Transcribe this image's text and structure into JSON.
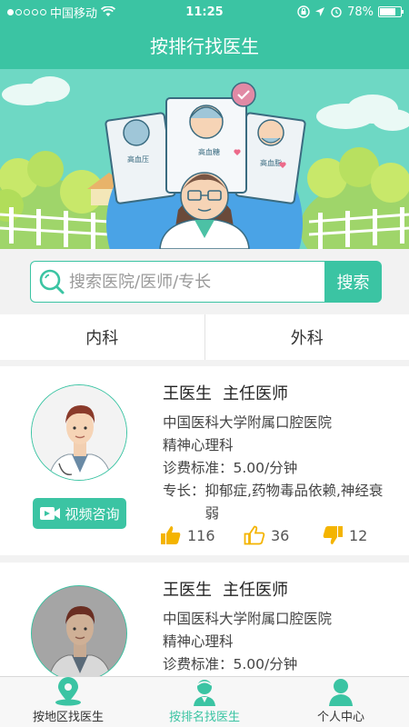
{
  "status_bar": {
    "carrier": "中国移动",
    "time": "11:25",
    "battery": "78%",
    "battery_level": 0.78
  },
  "header": {
    "title": "按排行找医生"
  },
  "banner": {
    "labels": [
      "高血压",
      "高血糖",
      "高血脂"
    ]
  },
  "search": {
    "placeholder": "搜索医院/医师/专长",
    "button_label": "搜索"
  },
  "tabs": [
    {
      "label": "内科"
    },
    {
      "label": "外科"
    }
  ],
  "doctors": [
    {
      "name": "王医生",
      "title": "主任医师",
      "hospital": "中国医科大学附属口腔医院",
      "department": "精神心理科",
      "fee_label": "诊费标准：",
      "fee": "5.00/分钟",
      "specialty_label": "专长：",
      "specialty": "抑郁症,药物毒品依赖,神经衰弱",
      "video_label": "视频咨询",
      "likes": "116",
      "thumbs": "36",
      "dislikes": "12"
    },
    {
      "name": "王医生",
      "title": "主任医师",
      "hospital": "中国医科大学附属口腔医院",
      "department": "精神心理科",
      "fee_label": "诊费标准：",
      "fee": "5.00/分钟"
    }
  ],
  "tabbar": [
    {
      "label": "按地区找医生",
      "icon": "location-icon"
    },
    {
      "label": "按排名找医生",
      "icon": "doctor-icon"
    },
    {
      "label": "个人中心",
      "icon": "person-icon"
    }
  ],
  "colors": {
    "accent": "#3bc4a3",
    "like": "#f4b400"
  }
}
